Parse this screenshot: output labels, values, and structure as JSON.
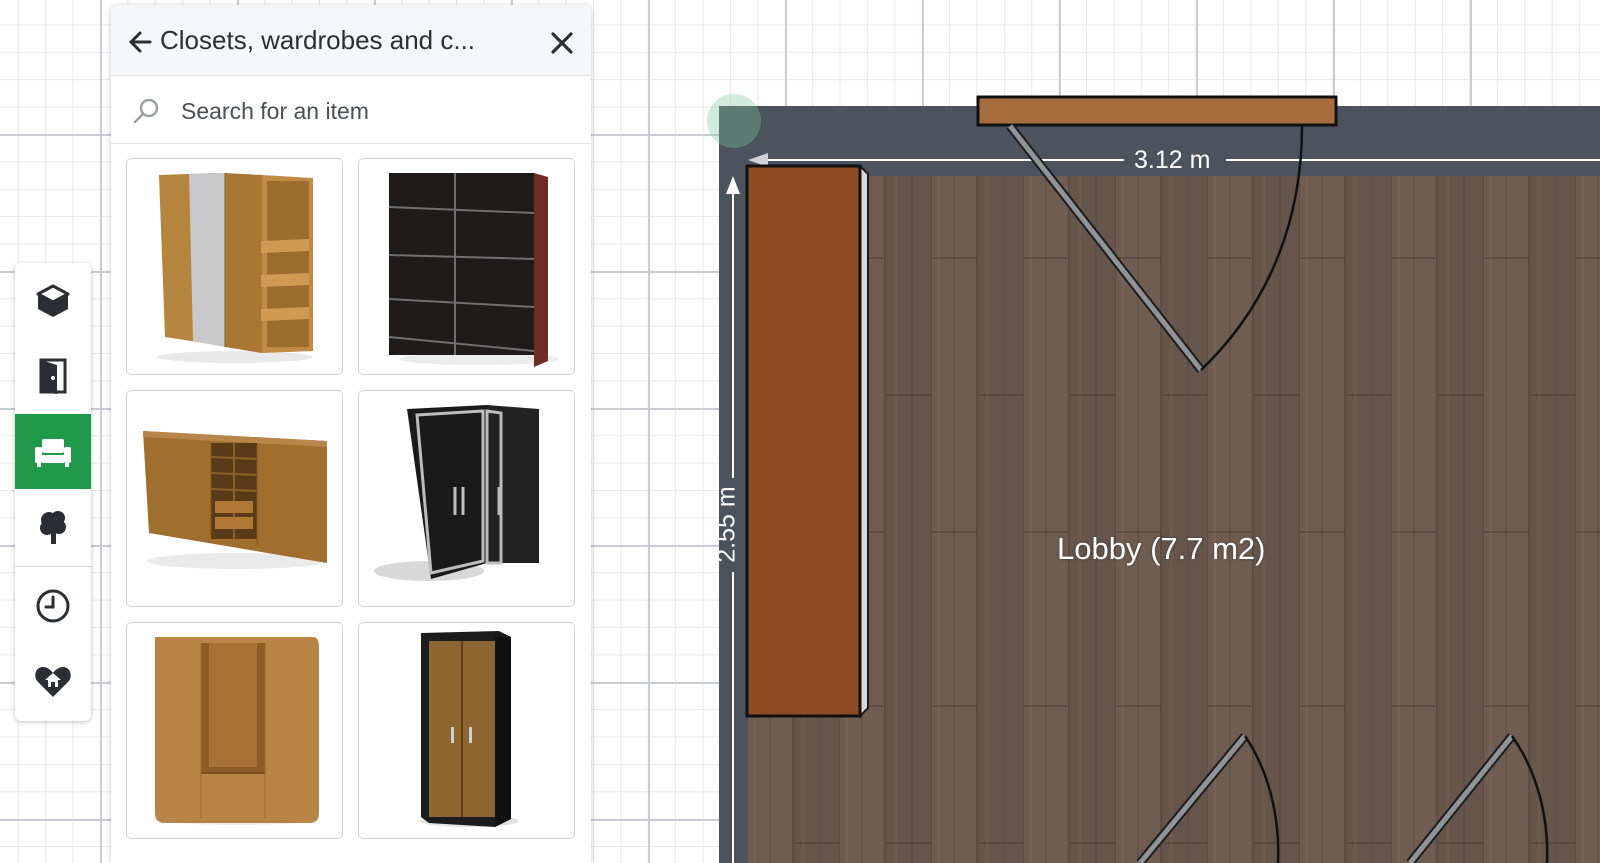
{
  "panel": {
    "title": "Closets, wardrobes and c...",
    "search_placeholder": "Search for an item"
  },
  "catalog": {
    "items": [
      {
        "name": "wardrobe-with-mirror-and-shelves"
      },
      {
        "name": "dark-sliding-door-wardrobe"
      },
      {
        "name": "low-wide-wardrobe-with-shelves"
      },
      {
        "name": "black-corner-wardrobe"
      },
      {
        "name": "wooden-wardrobe-with-open-niche"
      },
      {
        "name": "narrow-two-door-wardrobe"
      }
    ]
  },
  "rail": {
    "buttons": [
      {
        "icon": "3d-box-icon"
      },
      {
        "icon": "door-icon"
      },
      {
        "icon": "sofa-icon",
        "active": true
      },
      {
        "icon": "tree-icon"
      },
      {
        "icon": "clock-icon"
      },
      {
        "icon": "heart-home-icon"
      }
    ]
  },
  "plan": {
    "room_label": "Lobby (7.7 m2)",
    "width_dimension": "3.12 m",
    "height_dimension": "2.55 m"
  },
  "colors": {
    "accent": "#1f9a4a",
    "wall": "#4b535e",
    "floor": "#6b5a4d",
    "closet": "#8e4b22"
  }
}
